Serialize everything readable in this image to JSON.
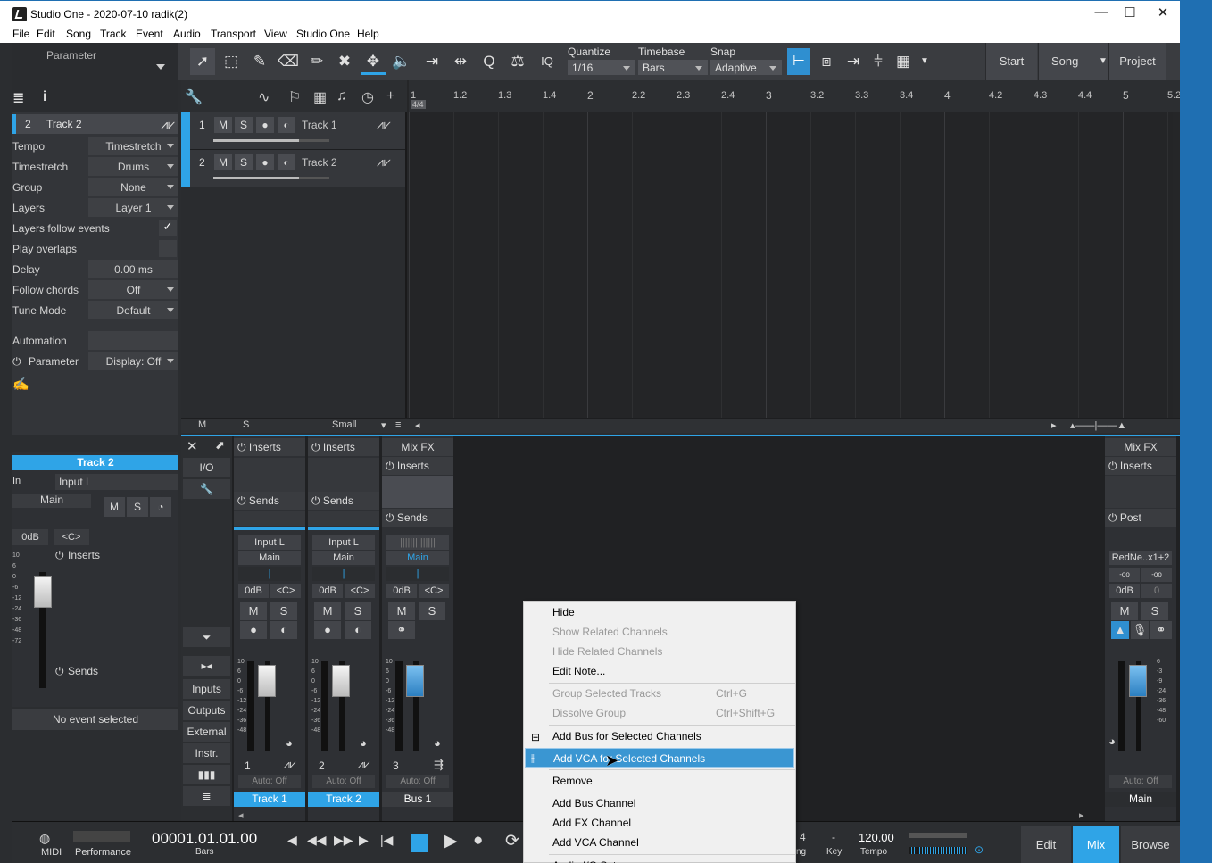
{
  "window": {
    "title": "Studio One - 2020-07-10 radik(2)"
  },
  "menu": [
    "File",
    "Edit",
    "Song",
    "Track",
    "Event",
    "Audio",
    "Transport",
    "View",
    "Studio One",
    "Help"
  ],
  "toolbar": {
    "parameter_label": "Parameter",
    "iq_label": "IQ",
    "quantize": {
      "label": "Quantize",
      "value": "1/16"
    },
    "timebase": {
      "label": "Timebase",
      "value": "Bars"
    },
    "snap": {
      "label": "Snap",
      "value": "Adaptive"
    },
    "nav": {
      "start": "Start",
      "song": "Song",
      "project": "Project"
    }
  },
  "inspector": {
    "track_number": "2",
    "track_name": "Track 2",
    "rows": [
      {
        "key": "Tempo",
        "value": "Timestretch"
      },
      {
        "key": "Timestretch",
        "value": "Drums"
      },
      {
        "key": "Group",
        "value": "None"
      },
      {
        "key": "Layers",
        "value": "Layer 1"
      },
      {
        "key": "Layers follow events",
        "value": "✓"
      },
      {
        "key": "Play overlaps",
        "value": ""
      },
      {
        "key": "Delay",
        "value": "0.00 ms"
      },
      {
        "key": "Follow chords",
        "value": "Off"
      },
      {
        "key": "Tune Mode",
        "value": "Default"
      }
    ],
    "automation_label": "Automation",
    "parameter_label": "Parameter",
    "display_label": "Display: Off"
  },
  "arrange": {
    "ruler": [
      "1",
      "1.2",
      "1.3",
      "1.4",
      "2",
      "2.2",
      "2.3",
      "2.4",
      "3",
      "3.2",
      "3.3",
      "3.4",
      "4",
      "4.2",
      "4.3",
      "4.4",
      "5",
      "5.2"
    ],
    "time_sig": "4/4",
    "tracks": [
      {
        "num": "1",
        "name": "Track 1",
        "m": "M",
        "s": "S"
      },
      {
        "num": "2",
        "name": "Track 2",
        "m": "M",
        "s": "S"
      }
    ],
    "footer": {
      "m": "M",
      "s": "S",
      "size": "Small"
    }
  },
  "left_channel": {
    "title": "Track 2",
    "in_label": "In",
    "input": "Input L",
    "out": "Main",
    "gain": "0dB",
    "pan": "<C>",
    "inserts": "Inserts",
    "sends": "Sends",
    "m": "M",
    "s": "S",
    "scale": [
      "10",
      "6",
      "0",
      "-6",
      "-12",
      "-24",
      "-36",
      "-48",
      "-72"
    ],
    "no_event": "No event selected"
  },
  "mixer": {
    "io_label": "I/O",
    "side_buttons": [
      "Inputs",
      "Outputs",
      "External",
      "Instr."
    ],
    "channels": [
      {
        "num": "1",
        "name": "Track 1",
        "input": "Input L",
        "out": "Main",
        "gain": "0dB",
        "pan": "<C>",
        "auto": "Auto: Off",
        "header": "Inserts",
        "sends": "Sends"
      },
      {
        "num": "2",
        "name": "Track 2",
        "input": "Input L",
        "out": "Main",
        "gain": "0dB",
        "pan": "<C>",
        "auto": "Auto: Off",
        "header": "Inserts",
        "sends": "Sends"
      },
      {
        "num": "3",
        "name": "Bus 1",
        "input": "",
        "out": "Main",
        "gain": "0dB",
        "pan": "<C>",
        "auto": "Auto: Off",
        "header": "Mix FX",
        "sends": "Sends",
        "inserts": "Inserts"
      }
    ],
    "scale": [
      "10",
      "6",
      "0",
      "-6",
      "-12",
      "-24",
      "-36",
      "-48"
    ],
    "main": {
      "header": "Mix FX",
      "inserts": "Inserts",
      "post": "Post",
      "plugin": "RedNe..x1+2",
      "val1": "-oo",
      "val2": "-oo",
      "gain": "0dB",
      "pan": "0",
      "auto": "Auto: Off",
      "name": "Main",
      "m": "M",
      "s": "S",
      "scale": [
        "6",
        "-3",
        "-9",
        "-24",
        "-36",
        "-48",
        "-60"
      ]
    }
  },
  "context_menu": {
    "items": [
      {
        "label": "Hide",
        "disabled": false
      },
      {
        "label": "Show Related Channels",
        "disabled": true
      },
      {
        "label": "Hide Related Channels",
        "disabled": true
      },
      {
        "label": "Edit Note...",
        "disabled": false
      },
      {
        "label": "Group Selected Tracks",
        "disabled": true,
        "shortcut": "Ctrl+G"
      },
      {
        "label": "Dissolve Group",
        "disabled": true,
        "shortcut": "Ctrl+Shift+G"
      },
      {
        "label": "Add Bus for Selected Channels",
        "disabled": false
      },
      {
        "label": "Add VCA for Selected Channels",
        "disabled": false,
        "highlighted": true
      },
      {
        "label": "Remove",
        "disabled": false
      },
      {
        "label": "Add Bus Channel",
        "disabled": false
      },
      {
        "label": "Add FX Channel",
        "disabled": false
      },
      {
        "label": "Add VCA Channel",
        "disabled": false
      },
      {
        "label": "Audio I/O Setup...",
        "disabled": false
      }
    ]
  },
  "transport": {
    "midi": "MIDI",
    "performance": "Performance",
    "position": "00001.01.01.00",
    "bars": "Bars",
    "key_val": "-",
    "key_label": "Key",
    "sig_val": "4",
    "sig_label": "ng",
    "tempo_val": "120.00",
    "tempo_label": "Tempo",
    "views": {
      "edit": "Edit",
      "mix": "Mix",
      "browse": "Browse"
    }
  },
  "colors": {
    "accent": "#2fa4e7",
    "highlight": "#3a96d2",
    "bg": "#2b2d30"
  }
}
